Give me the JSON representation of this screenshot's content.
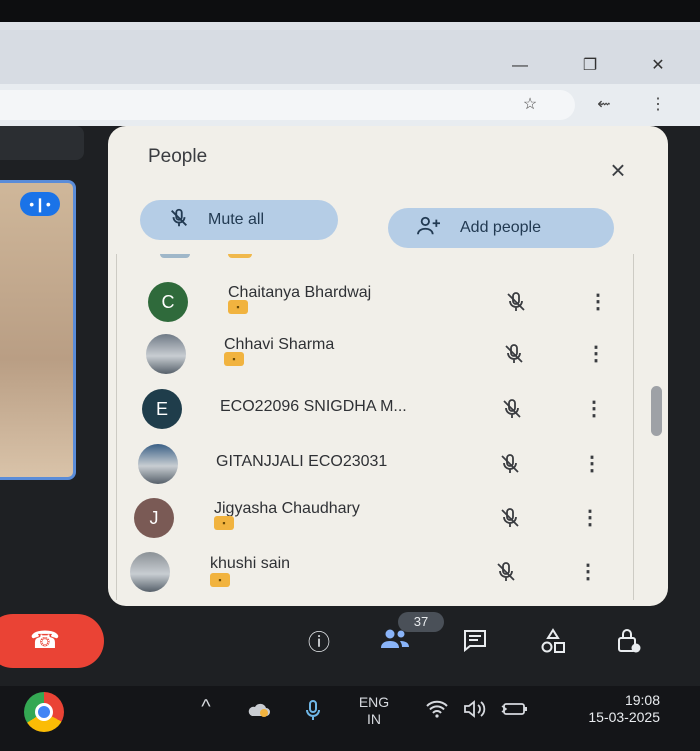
{
  "browser": {
    "minimize_icon": "—",
    "restore_icon": "❐",
    "close_icon": "✕",
    "star_icon": "☆",
    "extension_icon": "⇜",
    "menu_icon": "⋮"
  },
  "people_panel": {
    "title": "People",
    "mute_all_label": "Mute all",
    "add_people_label": "Add people",
    "participants": [
      {
        "initial": "C",
        "name": "Chaitanya Bhardwaj",
        "avatar_color": "#2f6a3b",
        "photo": false,
        "host_tag": true
      },
      {
        "initial": "",
        "name": "Chhavi Sharma",
        "avatar_color": "#6f7a86",
        "photo": true,
        "host_tag": true
      },
      {
        "initial": "E",
        "name": "ECO22096 SNIGDHA M...",
        "avatar_color": "#1f3d4b",
        "photo": false,
        "host_tag": false
      },
      {
        "initial": "",
        "name": "GITANJJALI ECO23031",
        "avatar_color": "#3a5f86",
        "photo": true,
        "host_tag": false
      },
      {
        "initial": "J",
        "name": "Jigyasha Chaudhary",
        "avatar_color": "#7a5a55",
        "photo": false,
        "host_tag": true
      },
      {
        "initial": "",
        "name": "khushi sain",
        "avatar_color": "#8b9196",
        "photo": true,
        "host_tag": true
      }
    ]
  },
  "controls": {
    "people_count": "37",
    "info_icon": "ⓘ",
    "people_icon": "👥",
    "chat_icon": "▤",
    "activities_icon": "◬",
    "lock_icon": "🔒",
    "hangup_icon": "☎"
  },
  "taskbar": {
    "language_line1": "ENG",
    "language_line2": "IN",
    "time": "19:08",
    "date": "15-03-2025",
    "chevron_icon": "^",
    "wifi_icon": "≋",
    "volume_icon": "🔊",
    "battery_icon": "▭"
  }
}
